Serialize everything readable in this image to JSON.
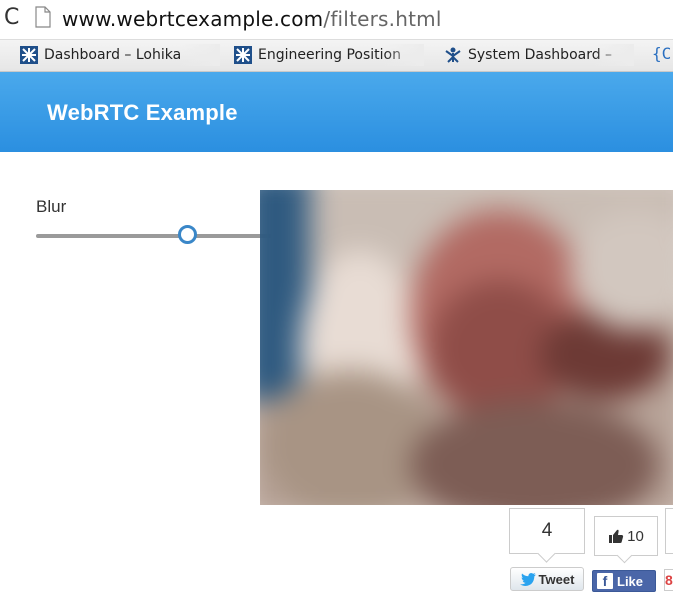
{
  "browser": {
    "url_host": "www.webrtcexample.com",
    "url_path": "/filters.html",
    "bookmarks": [
      {
        "label": "Dashboard – Lohika",
        "icon": "jira-icon"
      },
      {
        "label": "Engineering Position",
        "icon": "jira-icon"
      },
      {
        "label": "System Dashboard –",
        "icon": "atlassian-icon"
      }
    ],
    "bookmark_overflow": "{C"
  },
  "header": {
    "brand": "WebRTC Example",
    "color": "#2b8fe0"
  },
  "controls": {
    "blur_label": "Blur",
    "blur_level": 0.62,
    "thumb_color": "#3a87c8"
  },
  "social": {
    "tweet_count": "4",
    "tweet_label": "Tweet",
    "like_count": "10",
    "fb_like_label": "Like",
    "gplus_glyph": "8"
  }
}
